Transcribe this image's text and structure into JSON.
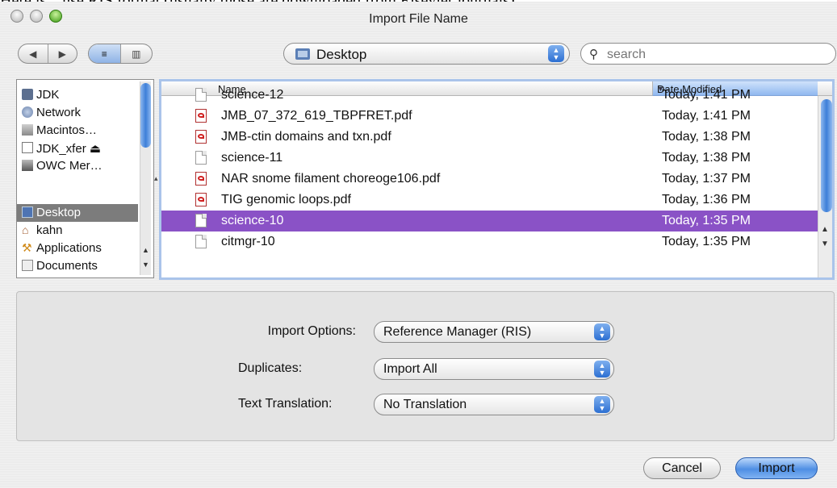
{
  "context_text": "Here is – use RIS format (usually those are downloaded from Elsevier journals).",
  "window": {
    "title": "Import File Name"
  },
  "toolbar": {
    "back_label": "◀",
    "forward_label": "▶",
    "list_view_label": "≡",
    "column_view_label": "▥",
    "location": "Desktop",
    "search_placeholder": "search"
  },
  "sidebar": {
    "items": [
      {
        "label": "JDK",
        "icon": "computer-icon"
      },
      {
        "label": "Network",
        "icon": "network-globe-icon"
      },
      {
        "label": "Macintos…",
        "icon": "hard-drive-icon"
      },
      {
        "label": "JDK_xfer ⏏",
        "icon": "external-drive-icon"
      },
      {
        "label": "OWC Mer…",
        "icon": "external-drive-icon"
      },
      {
        "label": "Desktop",
        "icon": "desktop-icon",
        "selected": true
      },
      {
        "label": "kahn",
        "icon": "home-icon"
      },
      {
        "label": "Applications",
        "icon": "applications-icon"
      },
      {
        "label": "Documents",
        "icon": "documents-icon"
      }
    ]
  },
  "file_list": {
    "columns": {
      "name": "Name",
      "date": "Date Modified"
    },
    "rows": [
      {
        "name": "science-12",
        "date": "Today, 1:41 PM",
        "type": "doc"
      },
      {
        "name": "JMB_07_372_619_TBPFRET.pdf",
        "date": "Today, 1:41 PM",
        "type": "pdf"
      },
      {
        "name": "JMB-ctin domains and txn.pdf",
        "date": "Today, 1:38 PM",
        "type": "pdf"
      },
      {
        "name": "science-11",
        "date": "Today, 1:38 PM",
        "type": "doc"
      },
      {
        "name": "NAR snome filament choreoge106.pdf",
        "date": "Today, 1:37 PM",
        "type": "pdf"
      },
      {
        "name": "TIG genomic loops.pdf",
        "date": "Today, 1:36 PM",
        "type": "pdf"
      },
      {
        "name": "science-10",
        "date": "Today, 1:35 PM",
        "type": "doc",
        "selected": true
      },
      {
        "name": "citmgr-10",
        "date": "Today, 1:35 PM",
        "type": "doc"
      }
    ]
  },
  "options": {
    "import_options_label": "Import Options:",
    "import_options_value": "Reference Manager (RIS)",
    "duplicates_label": "Duplicates:",
    "duplicates_value": "Import All",
    "text_translation_label": "Text Translation:",
    "text_translation_value": "No Translation"
  },
  "buttons": {
    "cancel": "Cancel",
    "import": "Import"
  },
  "colors": {
    "selection": "#8a52c6",
    "accent": "#3d7fd8",
    "sidebar_selection": "#7c7c7c"
  }
}
